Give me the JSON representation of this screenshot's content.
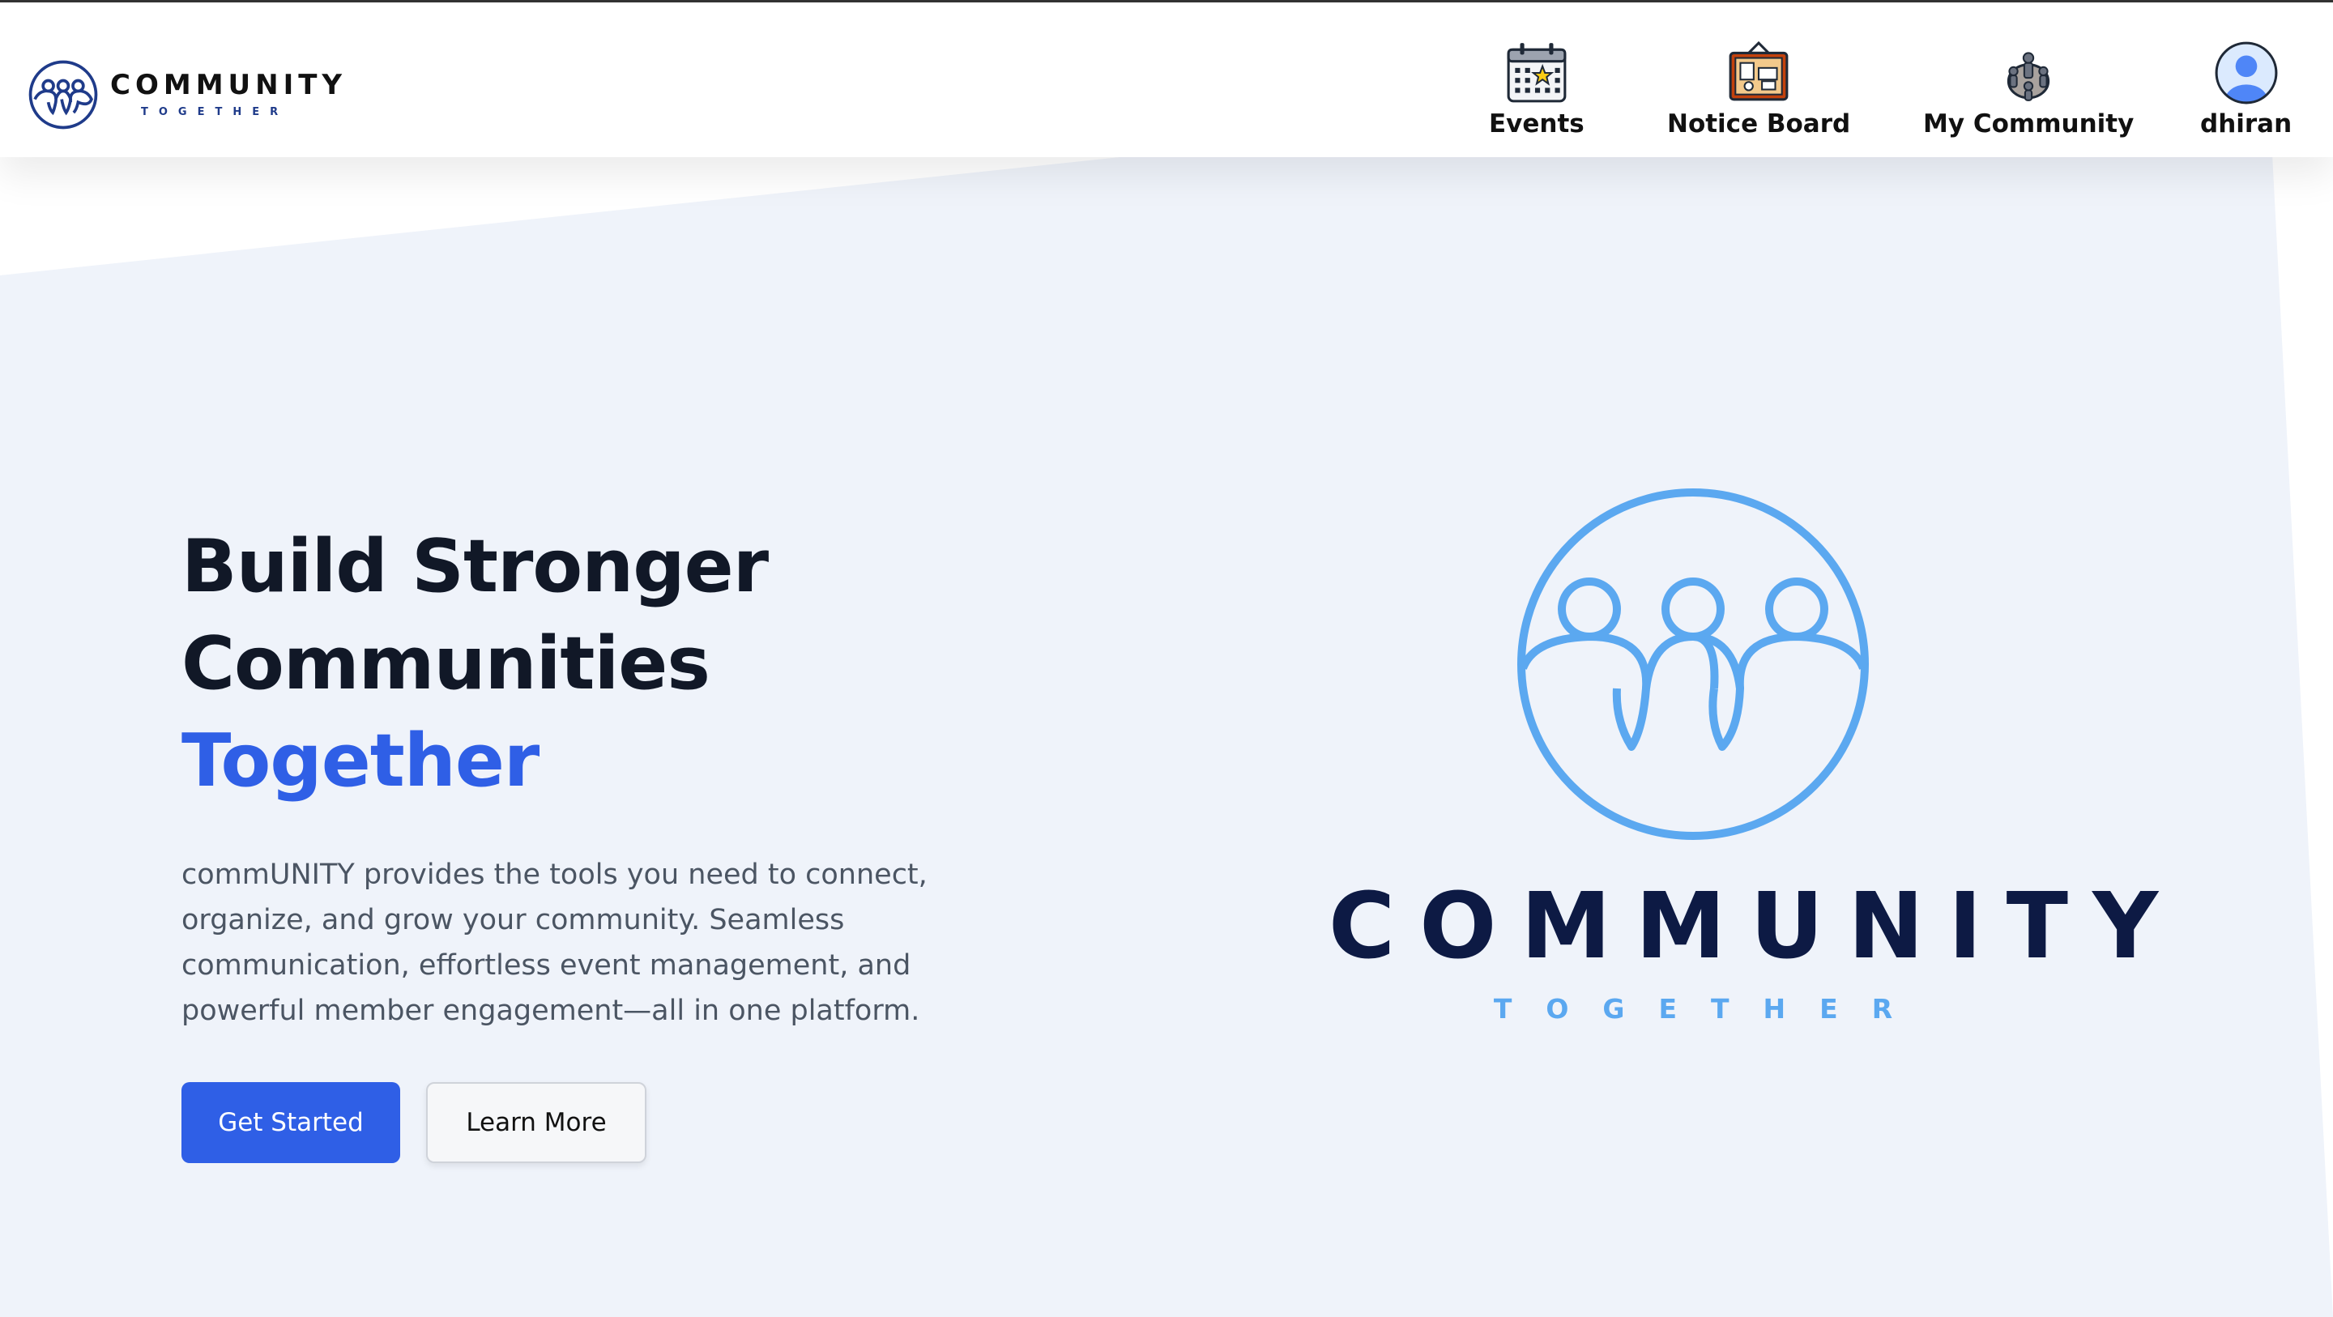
{
  "brand": {
    "title": "COMMUNITY",
    "subtitle": "TOGETHER",
    "logo_icon": "community-people-circle-icon"
  },
  "nav": {
    "items": [
      {
        "label": "Events",
        "icon": "calendar-icon"
      },
      {
        "label": "Notice Board",
        "icon": "notice-board-icon"
      },
      {
        "label": "My Community",
        "icon": "community-group-icon"
      },
      {
        "label": "dhiran",
        "icon": "user-avatar-icon"
      }
    ]
  },
  "hero": {
    "title_line1": "Build Stronger",
    "title_line2": "Communities",
    "title_accent": "Together",
    "description": "commUNITY provides the tools you need to connect, organize, and grow your community. Seamless communication, effortless event management, and powerful member engagement—all in one platform.",
    "primary_button": "Get Started",
    "secondary_button": "Learn More",
    "logo_title": "COMMUNITY",
    "logo_subtitle": "TOGETHER"
  },
  "colors": {
    "accent": "#2f5fe6",
    "logo_light_blue": "#5ba8f0",
    "logo_navy": "#0d1a44",
    "hero_background": "#eff3fa"
  }
}
